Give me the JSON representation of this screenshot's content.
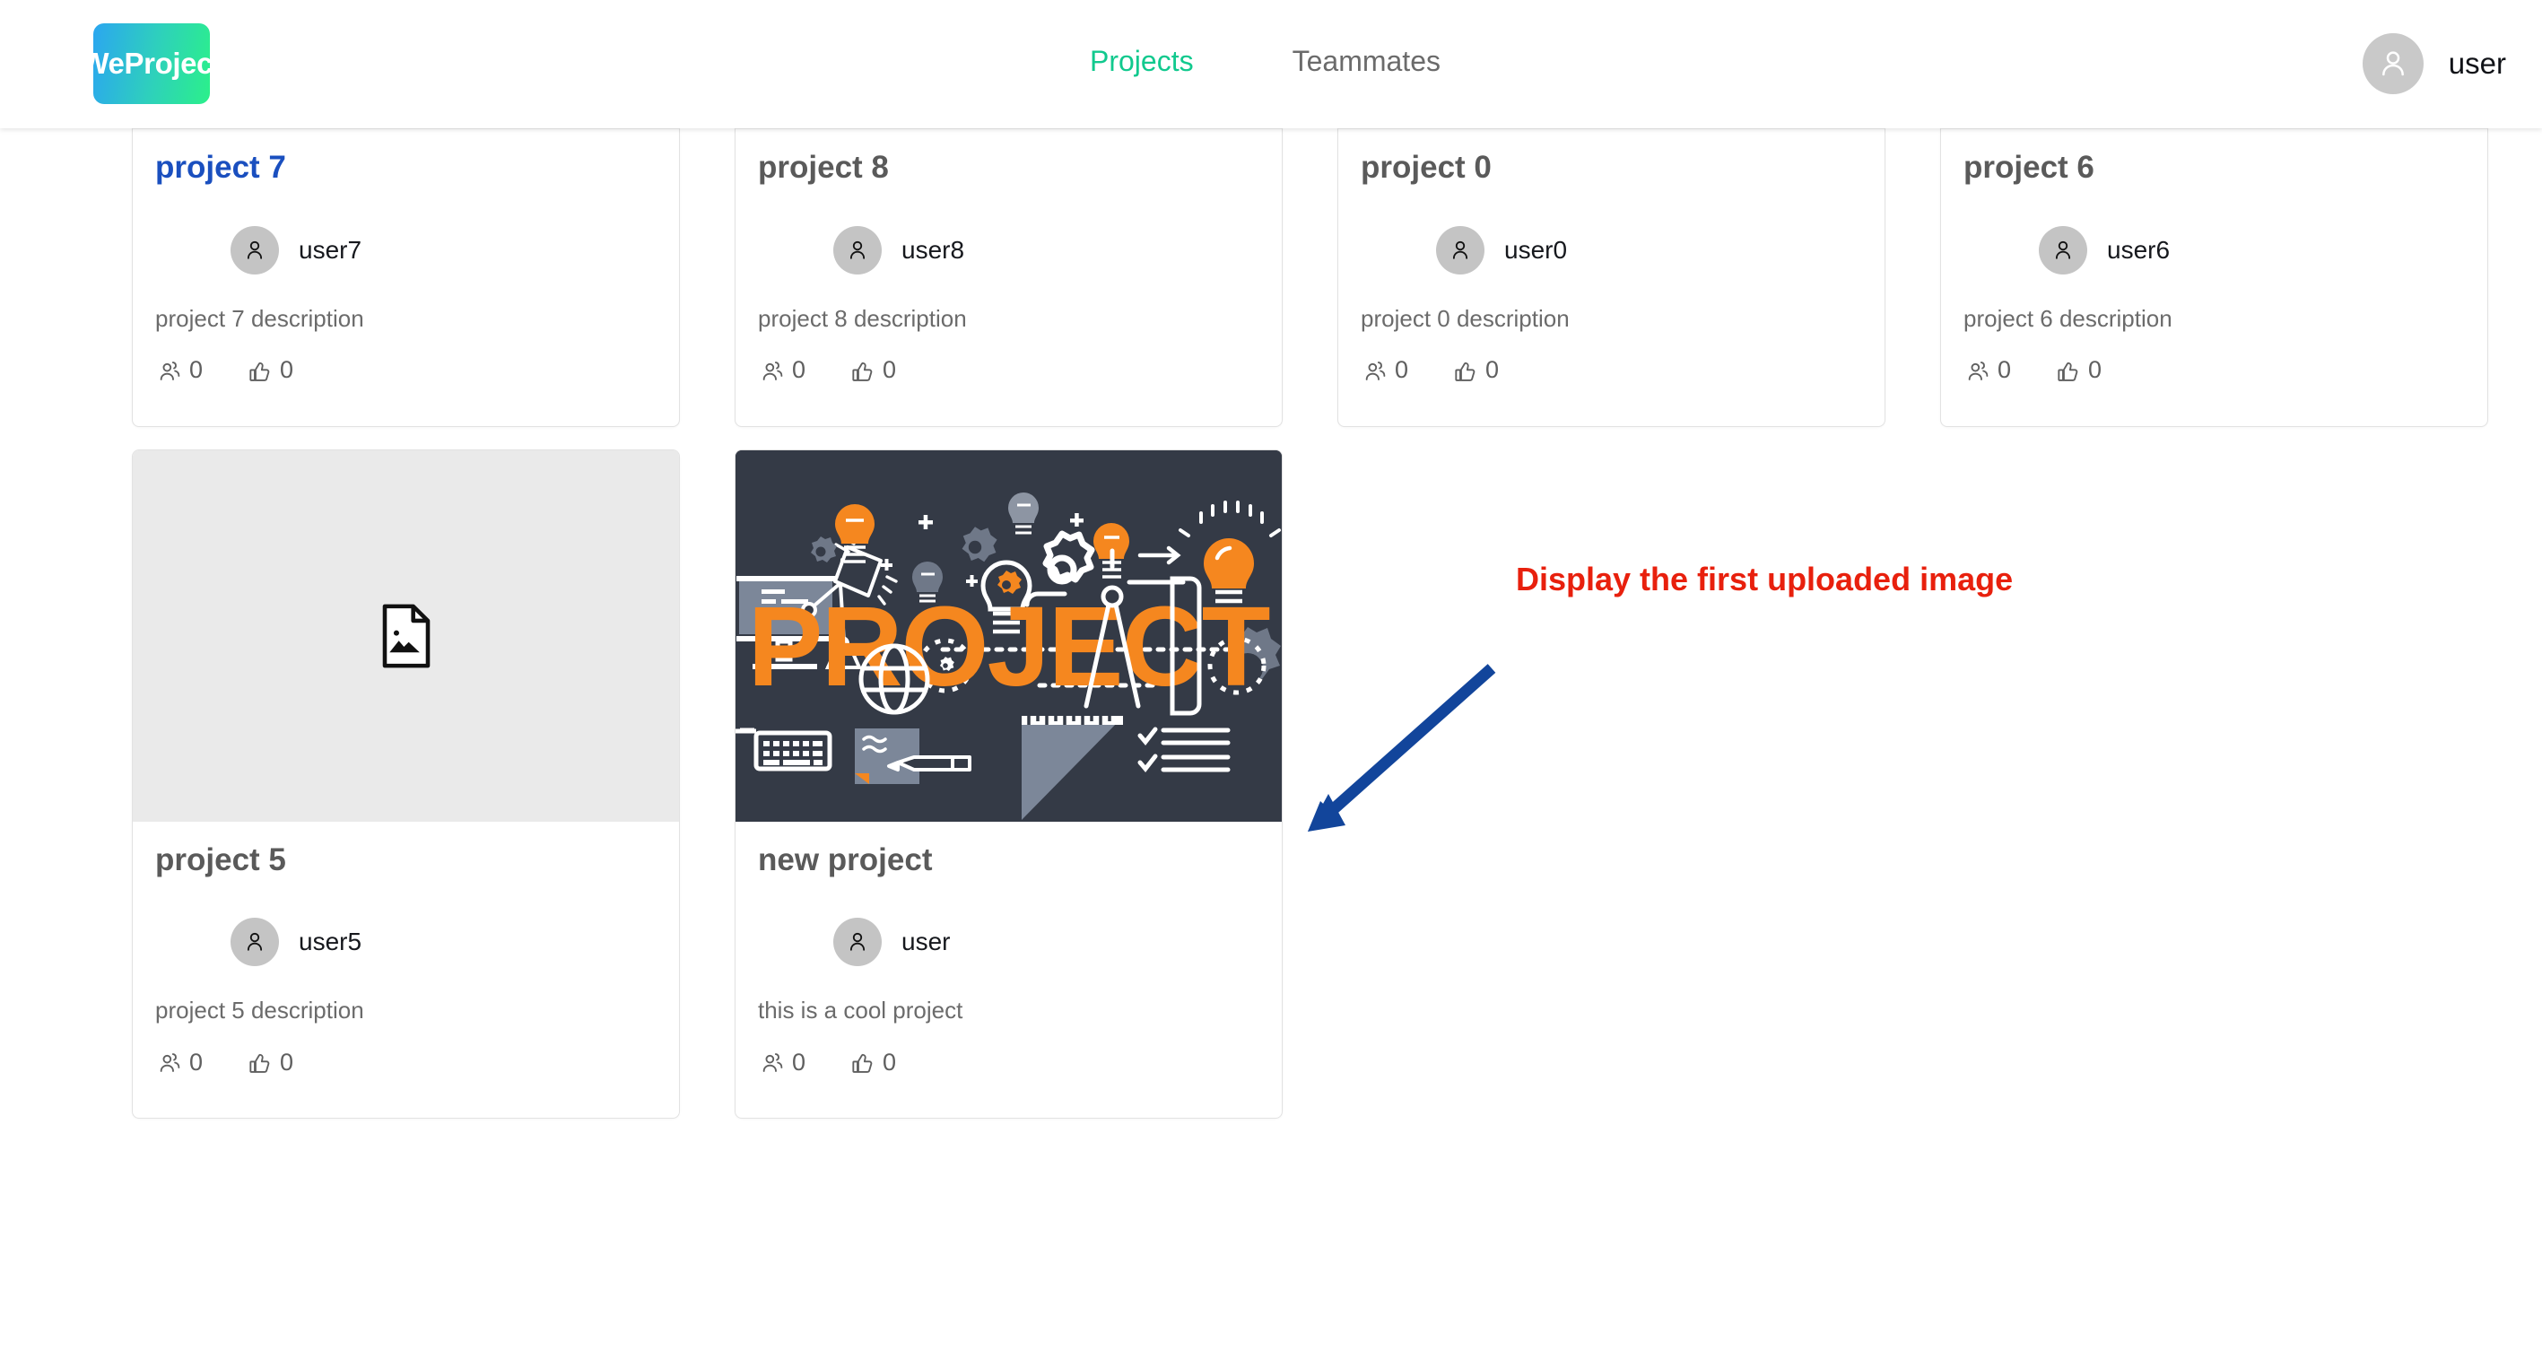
{
  "header": {
    "brand": "WeProject",
    "nav": [
      {
        "label": "Projects",
        "active": true
      },
      {
        "label": "Teammates",
        "active": false
      }
    ],
    "user": {
      "name": "user",
      "avatar_icon": "person-icon"
    },
    "colors": {
      "active_nav": "#11c98e",
      "inactive_nav": "#6b6b6b",
      "logo_gradient_from": "#2ba6f0",
      "logo_gradient_to": "#2bf08a"
    }
  },
  "projects": [
    {
      "title": "project 7",
      "owner": "user7",
      "description": "project 7 description",
      "members_count": "0",
      "likes_count": "0",
      "thumb": "empty",
      "title_state": "visited-link",
      "clipped": true
    },
    {
      "title": "project 8",
      "owner": "user8",
      "description": "project 8 description",
      "members_count": "0",
      "likes_count": "0",
      "thumb": "empty",
      "title_state": "normal",
      "clipped": true
    },
    {
      "title": "project 0",
      "owner": "user0",
      "description": "project 0 description",
      "members_count": "0",
      "likes_count": "0",
      "thumb": "empty",
      "title_state": "normal",
      "clipped": true
    },
    {
      "title": "project 6",
      "owner": "user6",
      "description": "project 6 description",
      "members_count": "0",
      "likes_count": "0",
      "thumb": "empty",
      "title_state": "normal",
      "clipped": true
    },
    {
      "title": "project 5",
      "owner": "user5",
      "description": "project 5 description",
      "members_count": "0",
      "likes_count": "0",
      "thumb": "broken-image",
      "title_state": "normal",
      "clipped": false
    },
    {
      "title": "new project",
      "owner": "user",
      "description": "this is a cool project",
      "members_count": "0",
      "likes_count": "0",
      "thumb": "project-illustration",
      "thumb_caption": "PROJECT",
      "title_state": "normal",
      "clipped": false
    }
  ],
  "icons": {
    "members": "people-icon",
    "likes": "thumbs-up-icon",
    "broken_image": "broken-image-icon"
  },
  "annotation": {
    "text": "Display the first uploaded image",
    "text_color": "#e8200d",
    "arrow_color": "#12459b"
  }
}
